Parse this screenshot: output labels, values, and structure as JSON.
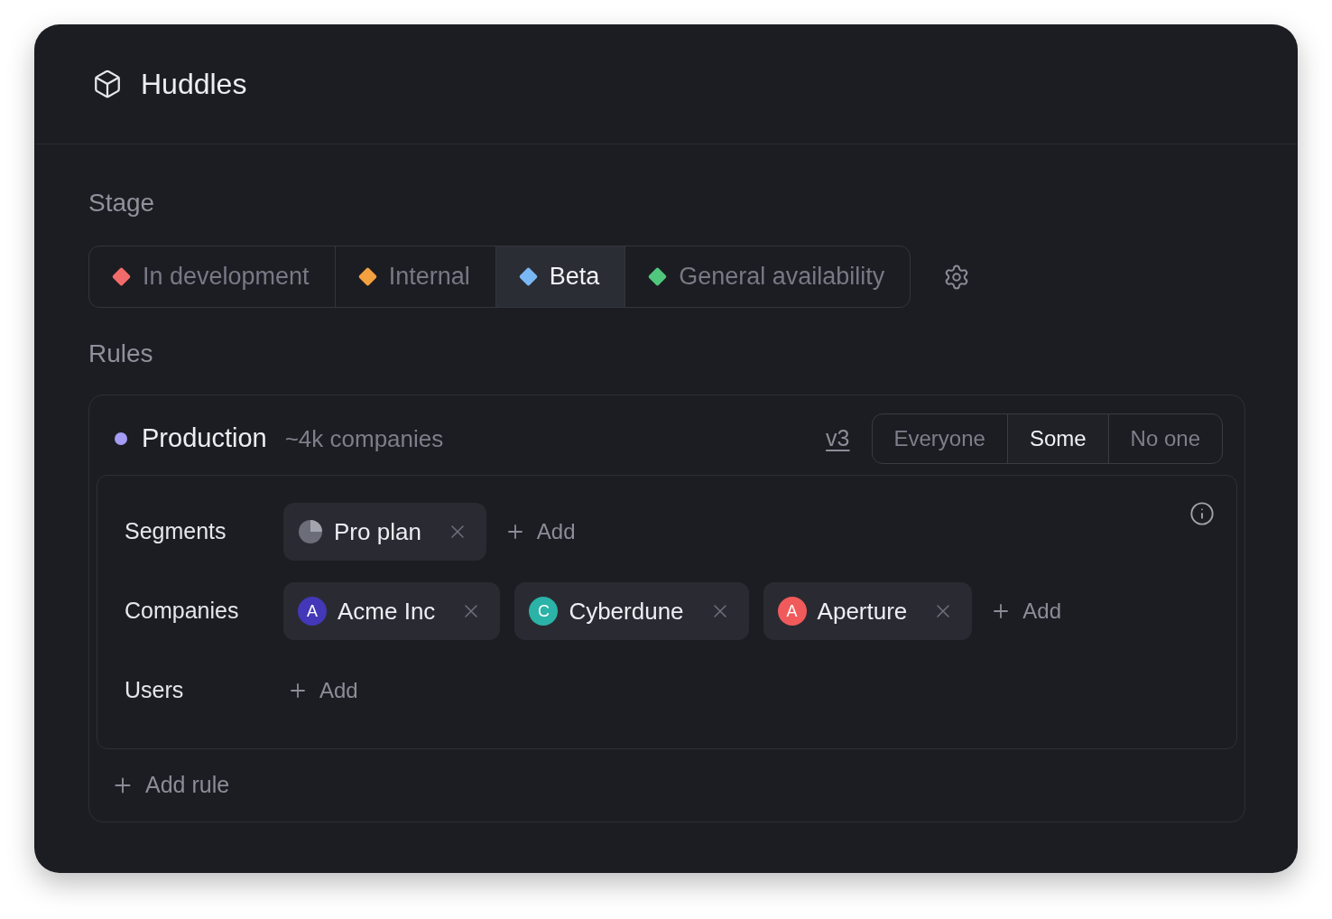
{
  "header": {
    "title": "Huddles"
  },
  "stage": {
    "label": "Stage",
    "options": [
      {
        "label": "In development",
        "color": "#f26b6b",
        "selected": false
      },
      {
        "label": "Internal",
        "color": "#f3a040",
        "selected": false
      },
      {
        "label": "Beta",
        "color": "#7ab8f5",
        "selected": true
      },
      {
        "label": "General availability",
        "color": "#4fc77c",
        "selected": false
      }
    ]
  },
  "rules": {
    "label": "Rules",
    "items": [
      {
        "name": "Production",
        "count": "~4k companies",
        "version": "v3",
        "audience": [
          {
            "label": "Everyone",
            "selected": false
          },
          {
            "label": "Some",
            "selected": true
          },
          {
            "label": "No one",
            "selected": false
          }
        ],
        "conditions": [
          {
            "label": "Segments",
            "chips": [
              {
                "kind": "segment",
                "label": "Pro plan"
              }
            ],
            "add": "Add"
          },
          {
            "label": "Companies",
            "chips": [
              {
                "kind": "company",
                "initial": "A",
                "label": "Acme Inc",
                "color": "#4338b8"
              },
              {
                "kind": "company",
                "initial": "C",
                "label": "Cyberdune",
                "color": "#2bb3a8"
              },
              {
                "kind": "company",
                "initial": "A",
                "label": "Aperture",
                "color": "#f05a5a"
              }
            ],
            "add": "Add"
          },
          {
            "label": "Users",
            "add": "Add"
          }
        ]
      }
    ],
    "add_rule": "Add rule"
  }
}
